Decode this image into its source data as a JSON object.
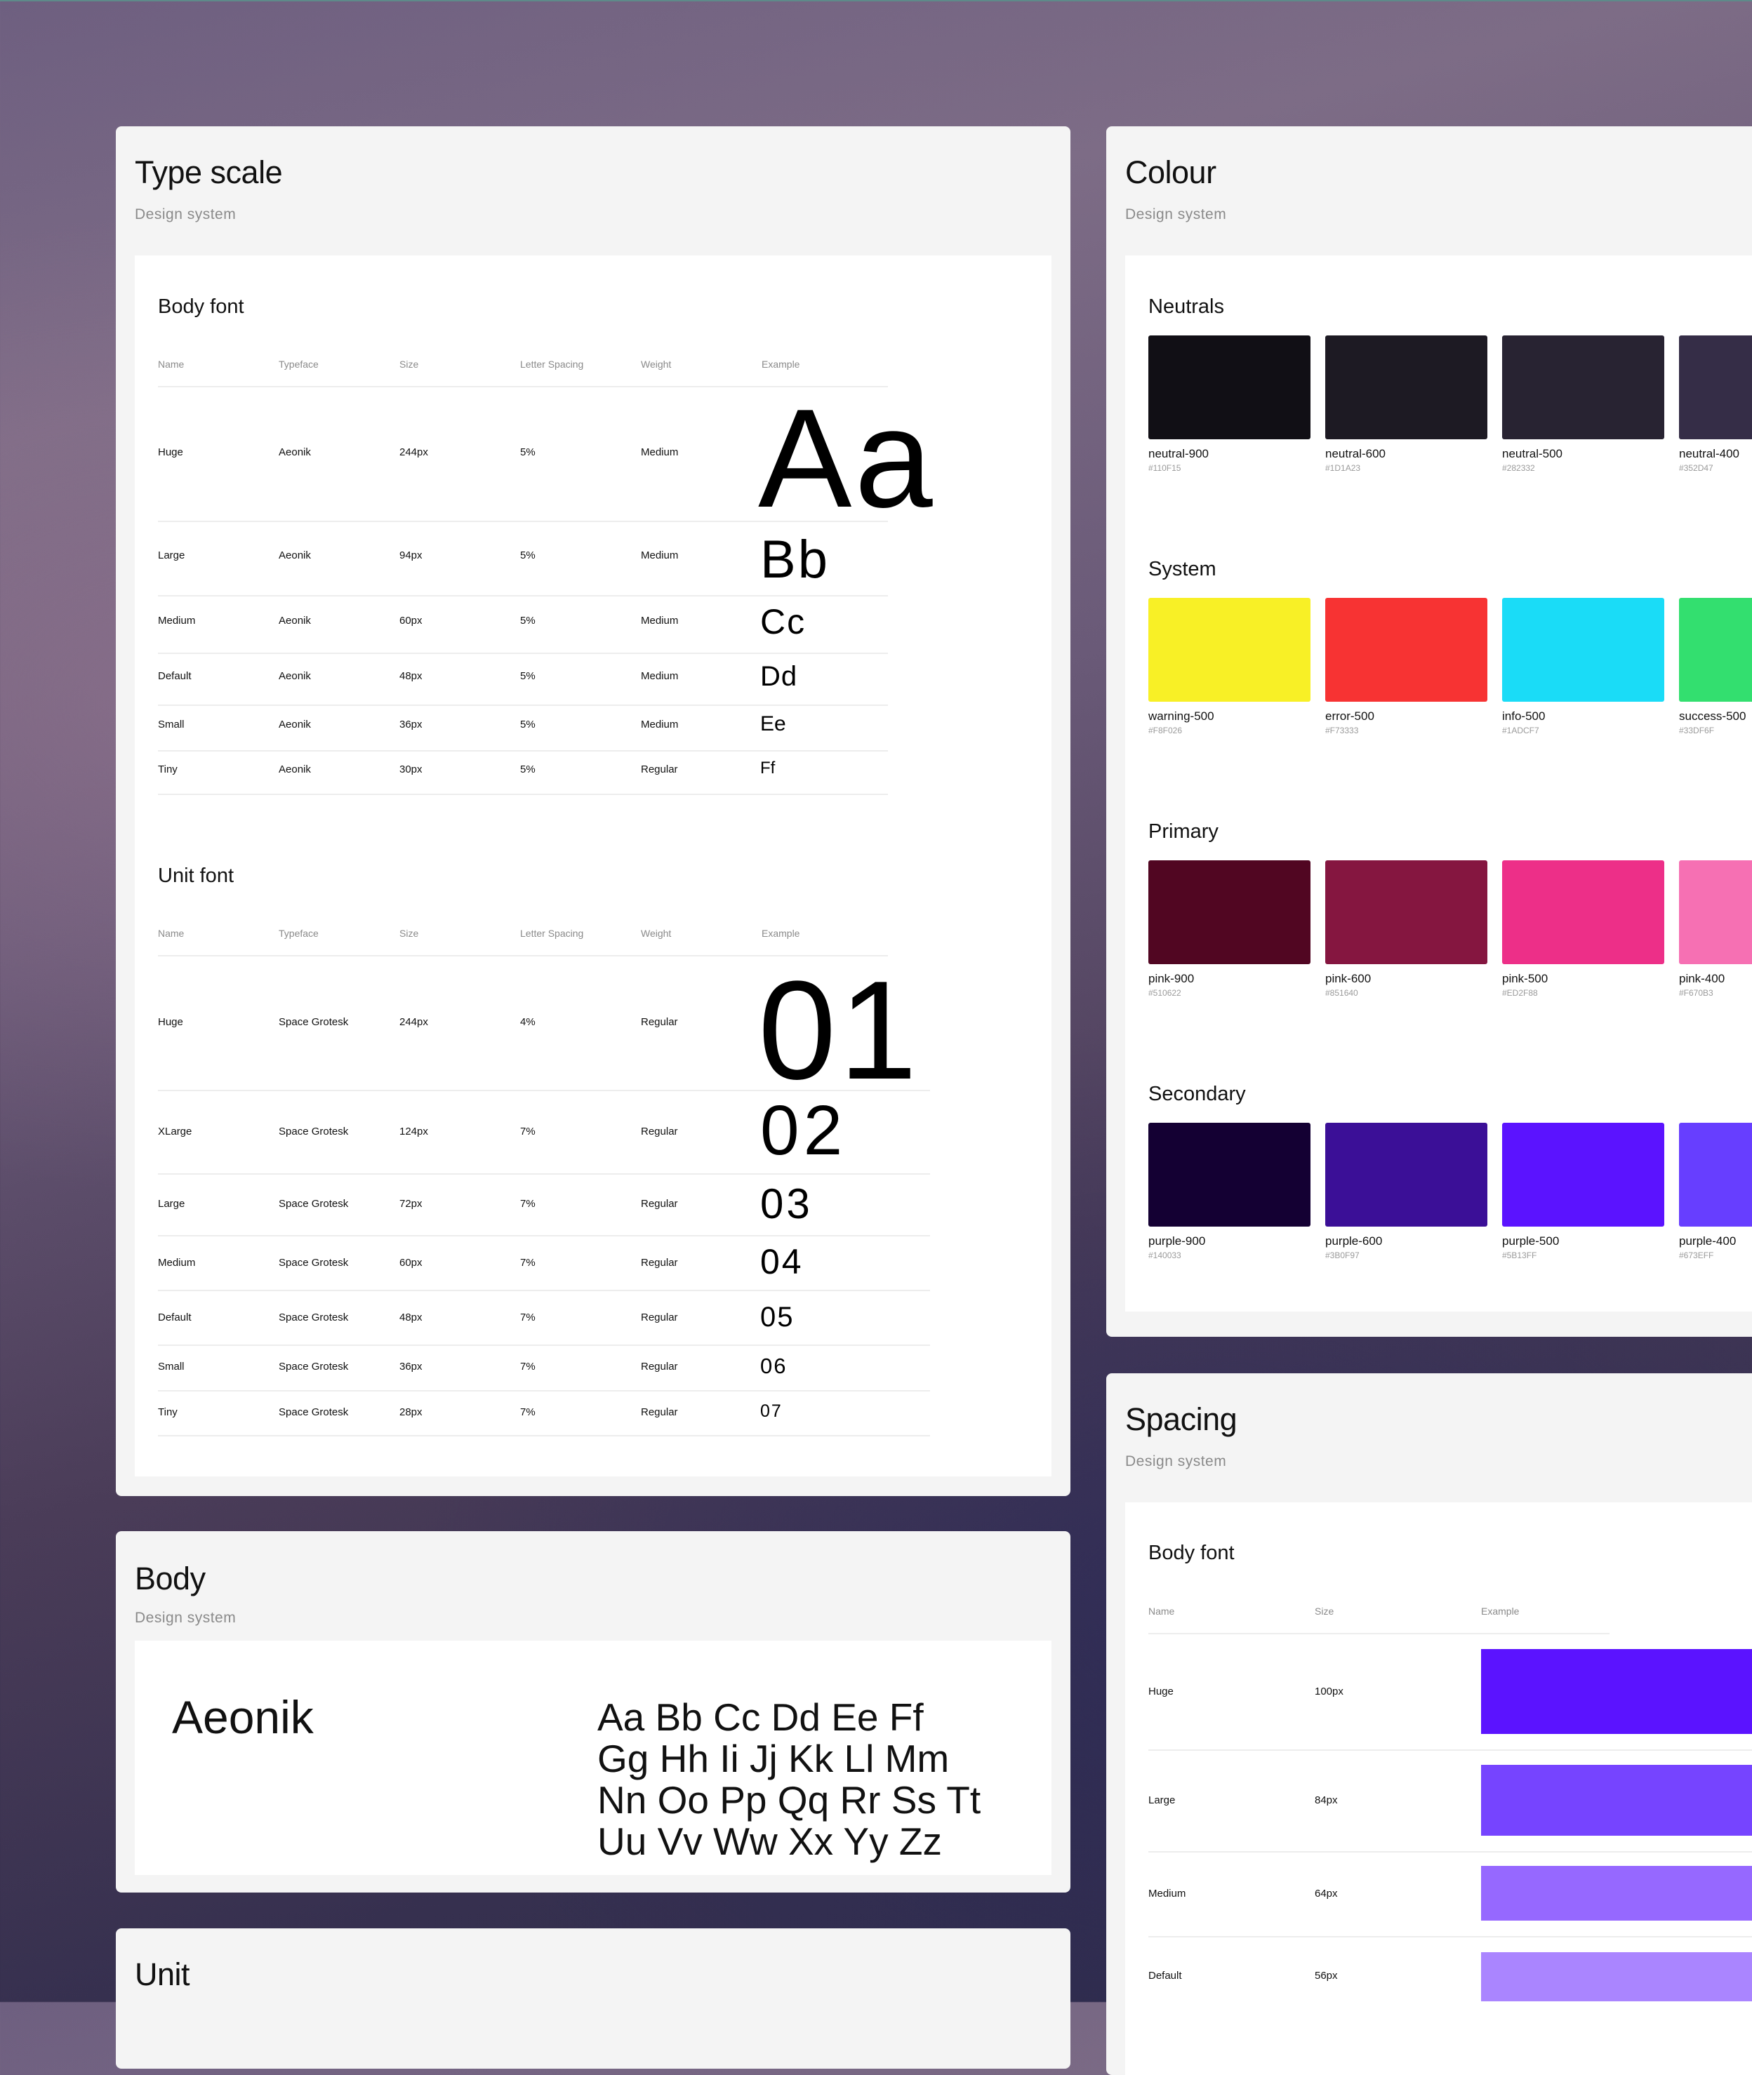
{
  "type_scale": {
    "title": "Type scale",
    "subtitle": "Design system",
    "body_font": {
      "title": "Body font",
      "headers": [
        "Name",
        "Typeface",
        "Size",
        "Letter Spacing",
        "Weight",
        "Example"
      ],
      "rows": [
        {
          "name": "Huge",
          "typeface": "Aeonik",
          "size": "244px",
          "spacing": "5%",
          "weight": "Medium",
          "example": "Aa"
        },
        {
          "name": "Large",
          "typeface": "Aeonik",
          "size": "94px",
          "spacing": "5%",
          "weight": "Medium",
          "example": "Bb"
        },
        {
          "name": "Medium",
          "typeface": "Aeonik",
          "size": "60px",
          "spacing": "5%",
          "weight": "Medium",
          "example": "Cc"
        },
        {
          "name": "Default",
          "typeface": "Aeonik",
          "size": "48px",
          "spacing": "5%",
          "weight": "Medium",
          "example": "Dd"
        },
        {
          "name": "Small",
          "typeface": "Aeonik",
          "size": "36px",
          "spacing": "5%",
          "weight": "Medium",
          "example": "Ee"
        },
        {
          "name": "Tiny",
          "typeface": "Aeonik",
          "size": "30px",
          "spacing": "5%",
          "weight": "Regular",
          "example": "Ff"
        }
      ]
    },
    "unit_font": {
      "title": "Unit font",
      "headers": [
        "Name",
        "Typeface",
        "Size",
        "Letter Spacing",
        "Weight",
        "Example"
      ],
      "rows": [
        {
          "name": "Huge",
          "typeface": "Space Grotesk",
          "size": "244px",
          "spacing": "4%",
          "weight": "Regular",
          "example": "01"
        },
        {
          "name": "XLarge",
          "typeface": "Space Grotesk",
          "size": "124px",
          "spacing": "7%",
          "weight": "Regular",
          "example": "02"
        },
        {
          "name": "Large",
          "typeface": "Space Grotesk",
          "size": "72px",
          "spacing": "7%",
          "weight": "Regular",
          "example": "03"
        },
        {
          "name": "Medium",
          "typeface": "Space Grotesk",
          "size": "60px",
          "spacing": "7%",
          "weight": "Regular",
          "example": "04"
        },
        {
          "name": "Default",
          "typeface": "Space Grotesk",
          "size": "48px",
          "spacing": "7%",
          "weight": "Regular",
          "example": "05"
        },
        {
          "name": "Small",
          "typeface": "Space Grotesk",
          "size": "36px",
          "spacing": "7%",
          "weight": "Regular",
          "example": "06"
        },
        {
          "name": "Tiny",
          "typeface": "Space Grotesk",
          "size": "28px",
          "spacing": "7%",
          "weight": "Regular",
          "example": "07"
        }
      ]
    }
  },
  "body": {
    "title": "Body",
    "subtitle": "Design system",
    "font_name": "Aeonik",
    "alphabet": [
      "Aa Bb Cc Dd Ee Ff",
      "Gg Hh Ii Jj Kk Ll Mm",
      "Nn Oo Pp Qq Rr Ss Tt",
      "Uu Vv Ww Xx Yy Zz"
    ]
  },
  "unit": {
    "title": "Unit"
  },
  "colour": {
    "title": "Colour",
    "subtitle": "Design system",
    "groups": [
      {
        "title": "Neutrals",
        "swatches": [
          {
            "name": "neutral-900",
            "hex": "#110F15"
          },
          {
            "name": "neutral-600",
            "hex": "#1D1A23"
          },
          {
            "name": "neutral-500",
            "hex": "#282332"
          },
          {
            "name": "neutral-400",
            "hex": "#352D47"
          }
        ]
      },
      {
        "title": "System",
        "swatches": [
          {
            "name": "warning-500",
            "hex": "#F8F026"
          },
          {
            "name": "error-500",
            "hex": "#F73333"
          },
          {
            "name": "info-500",
            "hex": "#1ADCF7"
          },
          {
            "name": "success-500",
            "hex": "#33DF6F"
          }
        ]
      },
      {
        "title": "Primary",
        "swatches": [
          {
            "name": "pink-900",
            "hex": "#510622"
          },
          {
            "name": "pink-600",
            "hex": "#851640"
          },
          {
            "name": "pink-500",
            "hex": "#ED2F88"
          },
          {
            "name": "pink-400",
            "hex": "#F670B3"
          }
        ]
      },
      {
        "title": "Secondary",
        "swatches": [
          {
            "name": "purple-900",
            "hex": "#140033"
          },
          {
            "name": "purple-600",
            "hex": "#3B0F97"
          },
          {
            "name": "purple-500",
            "hex": "#5B13FF"
          },
          {
            "name": "purple-400",
            "hex": "#673EFF"
          }
        ]
      }
    ]
  },
  "spacing": {
    "title": "Spacing",
    "subtitle": "Design system",
    "section_title": "Body font",
    "headers": [
      "Name",
      "Size",
      "Example"
    ],
    "rows": [
      {
        "name": "Huge",
        "size": "100px",
        "color": "#5B13FF"
      },
      {
        "name": "Large",
        "size": "84px",
        "color": "#7644FF"
      },
      {
        "name": "Medium",
        "size": "64px",
        "color": "#9668FF"
      },
      {
        "name": "Default",
        "size": "56px",
        "color": "#AA85FF"
      }
    ]
  }
}
